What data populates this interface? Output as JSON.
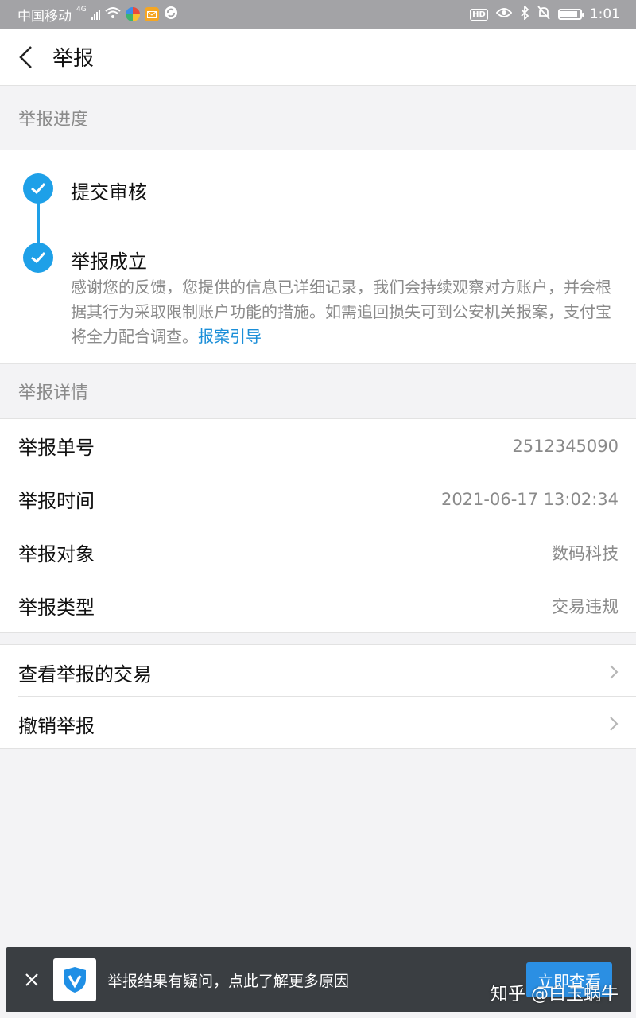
{
  "status_bar": {
    "carrier": "中国移动",
    "network": "4G",
    "time": "1:01",
    "hd_label": "HD",
    "battery_level": 0.9
  },
  "header": {
    "title": "举报"
  },
  "progress_section": {
    "label": "举报进度",
    "steps": [
      {
        "title": "提交审核"
      },
      {
        "title": "举报成立"
      }
    ],
    "description": "感谢您的反馈，您提供的信息已详细记录，我们会持续观察对方账户，并会根据其行为采取限制账户功能的措施。如需追回损失可到公安机关报案，支付宝将全力配合调查。",
    "link": "报案引导"
  },
  "details_section": {
    "label": "举报详情",
    "rows": [
      {
        "key": "举报单号",
        "value": "2512345090"
      },
      {
        "key": "举报时间",
        "value": "2021-06-17 13:02:34"
      },
      {
        "key": "举报对象",
        "value": "数码科技"
      },
      {
        "key": "举报类型",
        "value": "交易违规"
      }
    ]
  },
  "actions": [
    {
      "label": "查看举报的交易"
    },
    {
      "label": "撤销举报"
    }
  ],
  "banner": {
    "text": "举报结果有疑问，点此了解更多原因",
    "button": "立即查看"
  },
  "watermark": "知乎 @白玉蜗牛",
  "colors": {
    "accent": "#1ea0e8",
    "link": "#1a8ed8",
    "banner_bg": "#3a3e42"
  }
}
